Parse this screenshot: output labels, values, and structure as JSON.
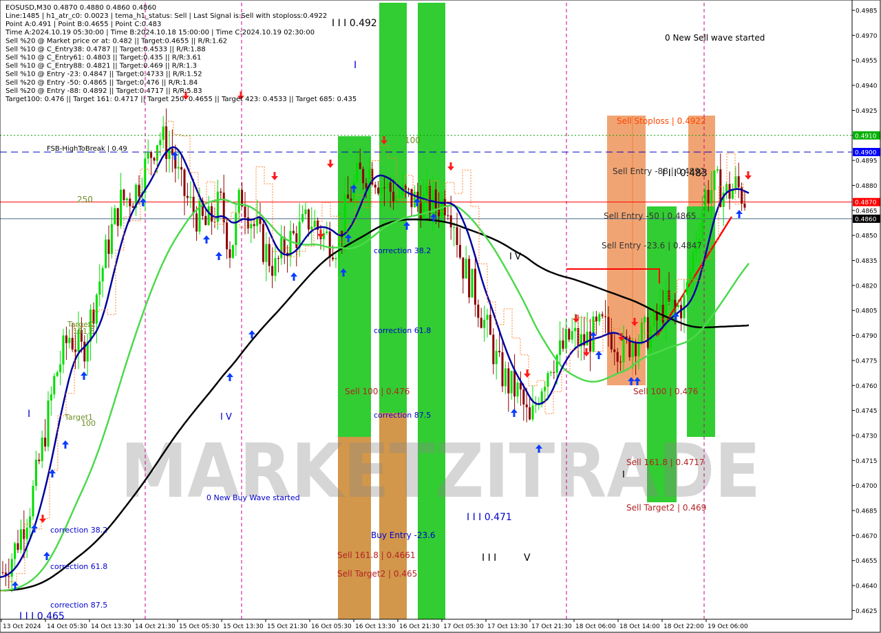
{
  "header": {
    "symbol_line": "EOSUSD,M30  0.4870 0.4880 0.4860 0.4860",
    "lines": [
      "Line:1485 | h1_atr_c0: 0.0023 | tema_h1_status: Sell | Last Signal is:Sell with stoploss:0.4922",
      "Point A:0.491 | Point B:0.4655 | Point C:0.483",
      "Time A:2024.10.19 05:30:00 | Time B:2024.10.18 15:00:00 | Time C:2024.10.19 02:30:00",
      "Sell %20 @ Market price or at: 0.482 || Target:0.4655 || R/R:1.62",
      "Sell %10 @ C_Entry38: 0.4787 || Target:0.4533 || R/R:1.88",
      "Sell %10 @ C_Entry61: 0.4803 || Target:0.435 || R/R:3.61",
      "Sell %10 @ C_Entry88: 0.4821 || Target:0.469 || R/R:1.3",
      "Sell %10 @ Entry -23: 0.4847 || Target:0.4733 || R/R:1.52",
      "Sell %20 @ Entry -50: 0.4865 || Target:0.476 || R/R:1.84",
      "Sell %20 @ Entry -88: 0.4892 || Target:0.4717 || R/R:5.83",
      "Target100: 0.476 || Target 161: 0.4717 || Target 250: 0.4655 || Target 423: 0.4533 || Target 685: 0.435"
    ]
  },
  "watermark": "MARKETZITRADE",
  "colors": {
    "bull": "#00dd00",
    "bear": "#8b0000",
    "green_zone": "#32cd32",
    "orange_zone": "#ee8d50",
    "blue_line": "#0000a0",
    "green_line": "#4cd94c",
    "black_line": "#000000",
    "red": "#ff0000",
    "orange_line": "#ff7f27",
    "magenta": "#c8008c",
    "blue_text": "#0000cc",
    "red_text": "#b22222",
    "olive_text": "#6b8e23"
  },
  "chart_data": {
    "type": "candlestick",
    "symbol": "EOSUSD",
    "timeframe": "M30",
    "ohlc_last": {
      "open": 0.487,
      "high": 0.488,
      "low": 0.486,
      "close": 0.486
    },
    "ylim": [
      0.4618,
      0.499
    ],
    "x_ticks": [
      "13 Oct 2024",
      "14 Oct 05:30",
      "14 Oct 13:30",
      "14 Oct 21:30",
      "15 Oct 05:30",
      "15 Oct 13:30",
      "15 Oct 21:30",
      "16 Oct 05:30",
      "16 Oct 13:30",
      "16 Oct 21:30",
      "17 Oct 05:30",
      "17 Oct 13:30",
      "17 Oct 21:30",
      "18 Oct 06:00",
      "18 Oct 14:00",
      "18 Oct 22:00",
      "19 Oct 06:00"
    ],
    "y_ticks": [
      "0.4985",
      "0.4970",
      "0.4955",
      "0.4940",
      "0.4925",
      "0.4910",
      "0.4895",
      "0.4880",
      "0.4865",
      "0.4850",
      "0.4835",
      "0.4820",
      "0.4805",
      "0.4790",
      "0.4775",
      "0.4760",
      "0.4745",
      "0.4730",
      "0.4715",
      "0.4700",
      "0.4685",
      "0.4670",
      "0.4655",
      "0.4640",
      "0.4625"
    ],
    "price_tags": [
      {
        "text": "0.4910",
        "value": 0.491,
        "color": "#00b000"
      },
      {
        "text": "0.4900",
        "value": 0.49,
        "color": "#0000ff"
      },
      {
        "text": "0.4870",
        "value": 0.487,
        "color": "#ff0000"
      },
      {
        "text": "0.4860",
        "value": 0.486,
        "color": "#000000"
      }
    ],
    "hlines": [
      {
        "value": 0.491,
        "color": "#00a000",
        "style": "dotted",
        "label": ""
      },
      {
        "value": 0.49,
        "color": "#0000cc",
        "style": "dashed",
        "label": "FSB-HighToBreak | 0.49"
      },
      {
        "value": 0.487,
        "color": "#ff0000",
        "style": "solid",
        "label": ""
      },
      {
        "value": 0.486,
        "color": "#446688",
        "style": "solid",
        "label": ""
      }
    ],
    "annotations": [
      {
        "text": "0 New Sell wave started",
        "color": "#000000"
      },
      {
        "text": "0 New Buy Wave started",
        "color": "#0000cc"
      },
      {
        "text": "I I I 0.492",
        "color": "#000000"
      },
      {
        "text": "I I I 0.471",
        "color": "#0000cc"
      },
      {
        "text": "I I I 0.465",
        "color": "#0000cc"
      },
      {
        "text": "I I I 0.483",
        "color": "#000000"
      },
      {
        "text": "I",
        "color": "#0000cc"
      },
      {
        "text": "I V",
        "color": "#0000cc"
      },
      {
        "text": "I V",
        "color": "#000000"
      },
      {
        "text": "I I I",
        "color": "#000000"
      },
      {
        "text": "V",
        "color": "#000000"
      },
      {
        "text": "I",
        "color": "#000000"
      },
      {
        "text": "I",
        "color": "#0000cc"
      },
      {
        "text": "correction 38.2",
        "color": "#0000cc"
      },
      {
        "text": "correction 61.8",
        "color": "#0000cc"
      },
      {
        "text": "correction 87.5",
        "color": "#0000cc"
      },
      {
        "text": "correction 38.2",
        "color": "#0000cc"
      },
      {
        "text": "correction 61.8",
        "color": "#0000cc"
      },
      {
        "text": "correction 87.5",
        "color": "#0000cc"
      },
      {
        "text": "Sell 100 | 0.476",
        "color": "#b22222"
      },
      {
        "text": "Sell 100 | 0.476",
        "color": "#b22222"
      },
      {
        "text": "Buy Entry -23.6",
        "color": "#0000cc"
      },
      {
        "text": "Sell 161.8 | 0.4661",
        "color": "#b22222"
      },
      {
        "text": "Sell Target2 | 0.465",
        "color": "#b22222"
      },
      {
        "text": "Sell Stoploss | 0.4922",
        "color": "#ff4500"
      },
      {
        "text": "Sell Entry -88 | 0.4892",
        "color": "#333333"
      },
      {
        "text": "Sell Entry -50 | 0.4865",
        "color": "#333333"
      },
      {
        "text": "Sell Entry -23.6 | 0.4847",
        "color": "#333333"
      },
      {
        "text": "Sell 161.8 | 0.4717",
        "color": "#b22222"
      },
      {
        "text": "Sell Target2 | 0.469",
        "color": "#b22222"
      },
      {
        "text": "250",
        "color": "#6b8e23"
      },
      {
        "text": "100",
        "color": "#6b8e23"
      },
      {
        "text": "100",
        "color": "#6b8e23"
      },
      {
        "text": "Target2",
        "color": "#6b8e23"
      },
      {
        "text": "161.8",
        "color": "#6b8e23"
      },
      {
        "text": "Target1",
        "color": "#6b8e23"
      }
    ]
  }
}
